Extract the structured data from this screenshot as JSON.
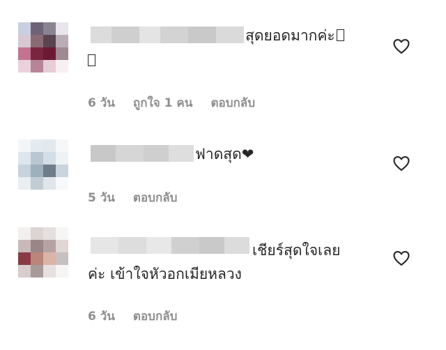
{
  "comments": [
    {
      "text_line1": "สุดยอดมากค่ะ",
      "text_line2": "",
      "age": "6 วัน",
      "likes": "ถูกใจ 1 คน",
      "reply": "ตอบกลับ",
      "has_heart_emoji": false
    },
    {
      "text_line1": "ฟาดสุด❤",
      "text_line2": "",
      "age": "5 วัน",
      "likes": "",
      "reply": "ตอบกลับ",
      "has_heart_emoji": true
    },
    {
      "text_line1": "เชียร์สุดใจเลย",
      "text_line2": "ค่ะ เข้าใจหัวอกเมียหลวง",
      "age": "6 วัน",
      "likes": "",
      "reply": "ตอบกลับ",
      "has_heart_emoji": false
    }
  ],
  "icons": {
    "like": "heart-outline-icon"
  },
  "colors": {
    "text": "#262626",
    "meta": "#8e8e8e"
  }
}
